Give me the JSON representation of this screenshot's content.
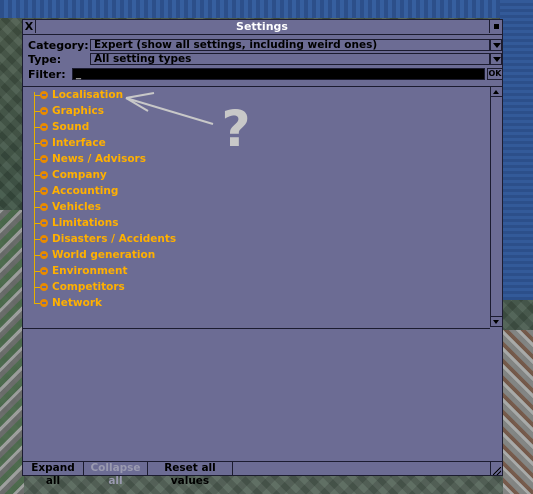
{
  "window": {
    "title": "Settings",
    "close_glyph": "X"
  },
  "filters": {
    "category_label": "Category:",
    "category_value": "Expert (show all settings, including weird ones)",
    "type_label": "Type:",
    "type_value": "All setting types",
    "filter_label": "Filter:",
    "filter_value": "_",
    "filter_ok": "OK"
  },
  "tree": {
    "items": [
      {
        "label": "Localisation"
      },
      {
        "label": "Graphics"
      },
      {
        "label": "Sound"
      },
      {
        "label": "Interface"
      },
      {
        "label": "News / Advisors"
      },
      {
        "label": "Company"
      },
      {
        "label": "Accounting"
      },
      {
        "label": "Vehicles"
      },
      {
        "label": "Limitations"
      },
      {
        "label": "Disasters / Accidents"
      },
      {
        "label": "World generation"
      },
      {
        "label": "Environment"
      },
      {
        "label": "Competitors"
      },
      {
        "label": "Network"
      }
    ]
  },
  "buttons": {
    "expand_all": "Expand all",
    "collapse_all": "Collapse all",
    "reset_all": "Reset all values"
  },
  "annotation": {
    "glyph": "?"
  },
  "colors": {
    "panel": "#6c6c94",
    "tree_text": "#ffb000",
    "title_text": "#ffffff",
    "annotation": "#c8c8c8"
  },
  "icons": [
    "close-icon",
    "sticky-icon",
    "dropdown-arrow-icon",
    "expand-icon",
    "scroll-up-icon",
    "scroll-down-icon",
    "resize-icon"
  ]
}
